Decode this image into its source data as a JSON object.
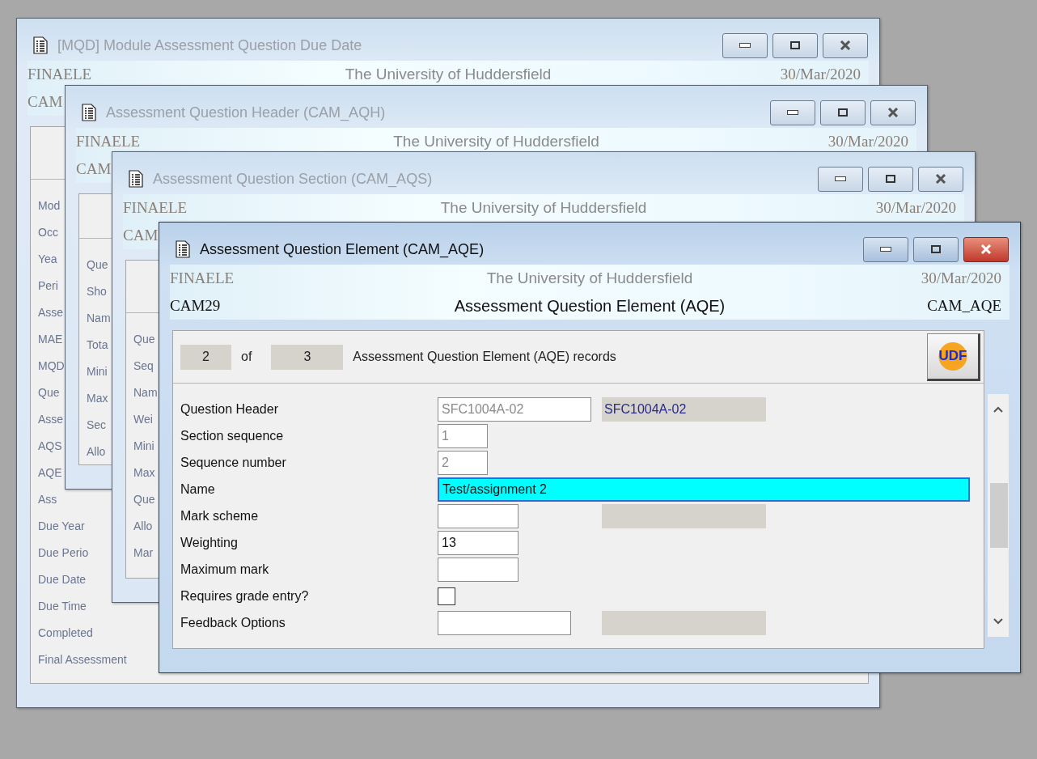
{
  "windows": [
    {
      "title": "[MQD] Module Assessment Question Due Date",
      "active": false,
      "company": "FINAELE",
      "institution": "The University of Huddersfield",
      "date": "30/Mar/2020",
      "code": "CAM",
      "labels": [
        "Mod",
        "Occ",
        "Yea",
        "Peri",
        "Asse",
        "MAE",
        "MQD",
        "Que",
        "Asse",
        "AQS",
        "AQE",
        "Ass",
        "Due Year",
        "Due Perio",
        "Due Date",
        "Due Time",
        "Completed",
        "Final Assessment"
      ]
    },
    {
      "title": "Assessment Question Header (CAM_AQH)",
      "active": false,
      "company": "FINAELE",
      "institution": "The University of Huddersfield",
      "date": "30/Mar/2020",
      "code": "CAM",
      "labels": [
        "Que",
        "Sho",
        "Nam",
        "Tota",
        "Mini",
        "Max",
        "Sec",
        "Allo"
      ]
    },
    {
      "title": "Assessment Question Section (CAM_AQS)",
      "active": false,
      "company": "FINAELE",
      "institution": "The University of Huddersfield",
      "date": "30/Mar/2020",
      "code": "CAM",
      "labels": [
        "Que",
        "Seq",
        "Nam",
        "Wei",
        "Mini",
        "Max",
        "Que",
        "Allo",
        "Mar"
      ]
    },
    {
      "title": "Assessment Question Element (CAM_AQE)",
      "active": true,
      "company": "FINAELE",
      "institution": "The University of Huddersfield",
      "date": "30/Mar/2020",
      "code": "CAM29",
      "form_title": "Assessment Question Element (AQE)",
      "form_code": "CAM_AQE",
      "record": {
        "current": "2",
        "of": "of",
        "total": "3",
        "label": "Assessment Question Element (AQE) records",
        "button": "UDF"
      },
      "fields": [
        {
          "label": "Question Header",
          "kind": "code",
          "value": "SFC1004A-02",
          "disabled": true,
          "focused": false,
          "lookup_box": true,
          "lookup": "SFC1004A-02"
        },
        {
          "label": "Section sequence",
          "kind": "number",
          "value": "1",
          "disabled": true,
          "focused": false
        },
        {
          "label": "Sequence number",
          "kind": "number",
          "value": "2",
          "disabled": true,
          "focused": false
        },
        {
          "label": "Name",
          "kind": "wide",
          "value": "Test/assignment 2",
          "disabled": false,
          "focused": true
        },
        {
          "label": "Mark scheme",
          "kind": "text",
          "focused": false,
          "lookup_box": true
        },
        {
          "label": "Weighting",
          "kind": "text",
          "value": "13",
          "disabled": false,
          "focused": false
        },
        {
          "label": "Maximum mark",
          "kind": "text",
          "focused": false
        },
        {
          "label": "Requires grade entry?",
          "kind": "checkbox",
          "checked": false
        },
        {
          "label": "Feedback Options",
          "kind": "option",
          "focused": false,
          "lookup_box": true
        }
      ]
    }
  ]
}
